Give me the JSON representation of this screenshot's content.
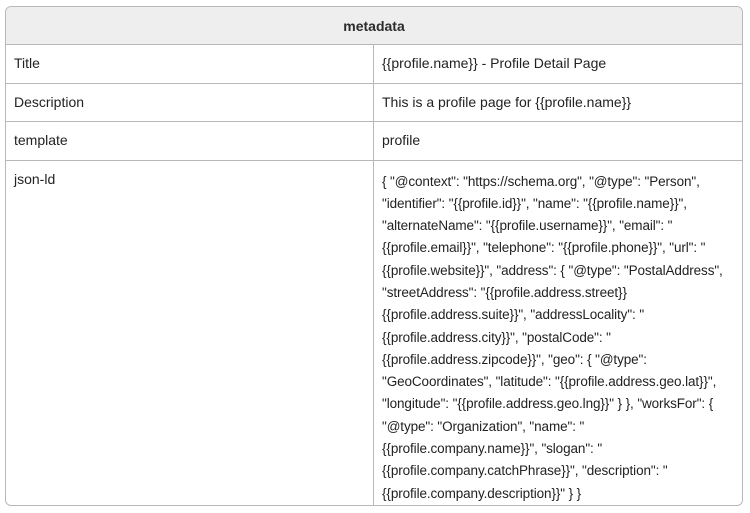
{
  "table": {
    "header": "metadata",
    "rows": [
      {
        "key": "Title",
        "value": "{{profile.name}} - Profile Detail Page"
      },
      {
        "key": "Description",
        "value": "This is a profile page for {{profile.name}}"
      },
      {
        "key": "template",
        "value": "profile"
      },
      {
        "key": "json-ld",
        "value": "{ \"@context\": \"https://schema.org\", \"@type\": \"Person\", \"identifier\": \"{{profile.id}}\", \"name\": \"{{profile.name}}\", \"alternateName\": \"{{profile.username}}\", \"email\": \"{{profile.email}}\", \"telephone\": \"{{profile.phone}}\", \"url\": \"{{profile.website}}\", \"address\": { \"@type\": \"PostalAddress\", \"streetAddress\": \"{{profile.address.street}} {{profile.address.suite}}\", \"addressLocality\": \"{{profile.address.city}}\", \"postalCode\": \"{{profile.address.zipcode}}\", \"geo\": { \"@type\": \"GeoCoordinates\", \"latitude\": \"{{profile.address.geo.lat}}\", \"longitude\": \"{{profile.address.geo.lng}}\" } }, \"worksFor\": { \"@type\": \"Organization\", \"name\": \"{{profile.company.name}}\", \"slogan\": \"{{profile.company.catchPhrase}}\", \"description\": \"{{profile.company.description}}\" } }"
      }
    ]
  }
}
